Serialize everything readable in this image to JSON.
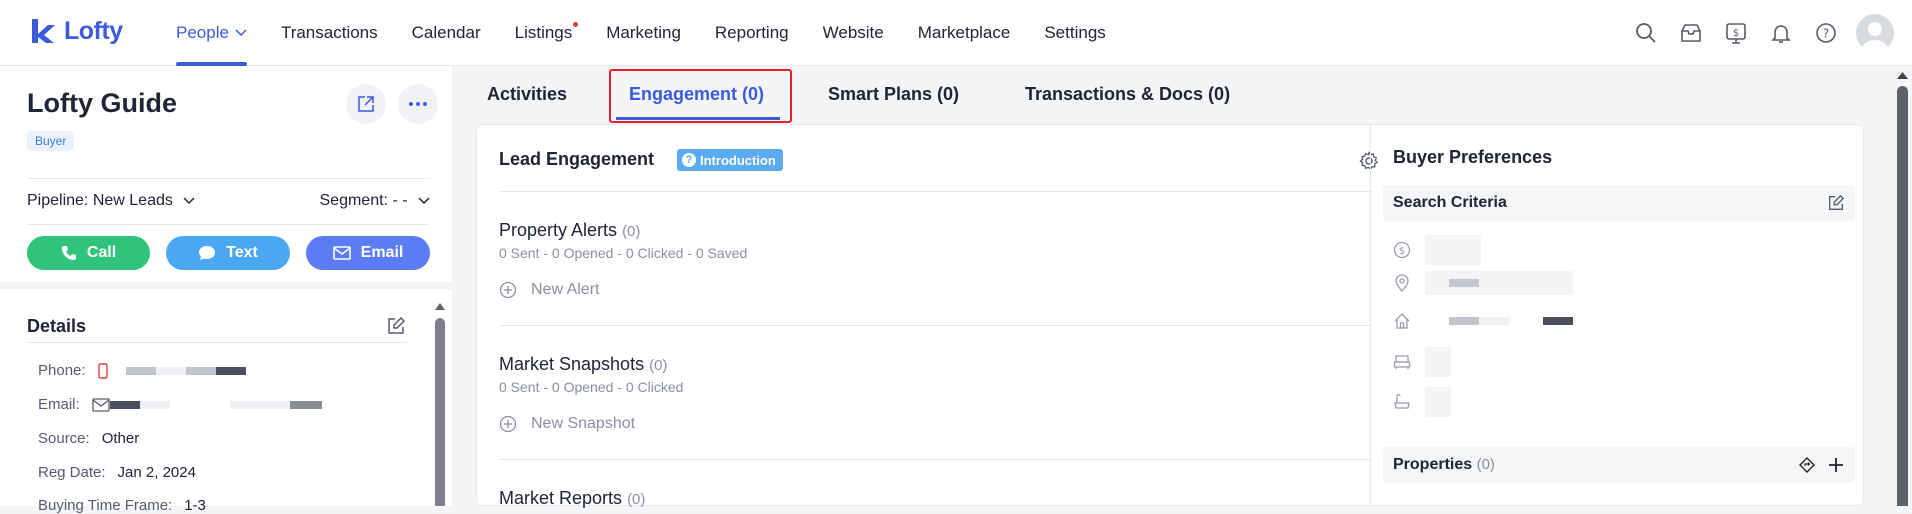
{
  "app": {
    "brand": "Lofty"
  },
  "nav": {
    "items": [
      {
        "label": "People",
        "active": true
      },
      {
        "label": "Transactions"
      },
      {
        "label": "Calendar"
      },
      {
        "label": "Listings",
        "dot": true
      },
      {
        "label": "Marketing"
      },
      {
        "label": "Reporting"
      },
      {
        "label": "Website"
      },
      {
        "label": "Marketplace"
      },
      {
        "label": "Settings"
      }
    ],
    "icons": [
      "search-icon",
      "inbox-icon",
      "billing-icon",
      "bell-icon",
      "help-icon",
      "avatar"
    ]
  },
  "contact": {
    "name": "Lofty Guide",
    "badge": "Buyer",
    "pipeline_label": "Pipeline:",
    "pipeline_value": "New Leads",
    "segment_label": "Segment:",
    "segment_value": "- -",
    "actions": {
      "call": "Call",
      "text": "Text",
      "email": "Email"
    },
    "colors": {
      "call": "#2fc47a",
      "text": "#4aa7f0",
      "email": "#5b7cf2"
    }
  },
  "details": {
    "title": "Details",
    "phone_label": "Phone:",
    "email_label": "Email:",
    "source_label": "Source:",
    "source_value": "Other",
    "reg_label": "Reg Date:",
    "reg_value": "Jan 2, 2024",
    "buying_label": "Buying Time Frame:",
    "buying_value": "1-3"
  },
  "tabs": {
    "activities": "Activities",
    "engagement": "Engagement (0)",
    "smart_plans": "Smart Plans (0)",
    "transactions": "Transactions & Docs (0)"
  },
  "lead": {
    "title": "Lead Engagement",
    "intro": "Introduction",
    "property_alerts": {
      "title": "Property Alerts",
      "count": "(0)",
      "stats": "0 Sent - 0 Opened - 0 Clicked - 0 Saved",
      "action": "New Alert"
    },
    "market_snapshots": {
      "title": "Market Snapshots",
      "count": "(0)",
      "stats": "0 Sent - 0 Opened - 0 Clicked",
      "action": "New Snapshot"
    },
    "market_reports": {
      "title": "Market Reports",
      "count": "(0)"
    }
  },
  "buyer": {
    "title": "Buyer Preferences",
    "search_criteria": "Search Criteria",
    "properties": "Properties",
    "properties_count": "(0)"
  }
}
